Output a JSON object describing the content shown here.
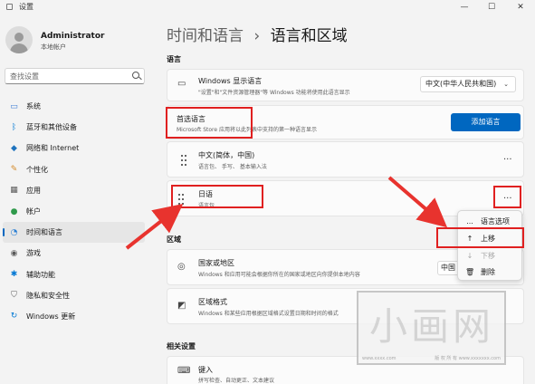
{
  "window": {
    "title": "设置",
    "controls": [
      "—",
      "☐",
      "✕"
    ]
  },
  "user": {
    "name": "Administrator",
    "account": "本地帐户"
  },
  "search": {
    "placeholder": "查找设置",
    "icon": "search-icon"
  },
  "sidebar": {
    "items": [
      {
        "label": "系统",
        "icon": "monitor-icon"
      },
      {
        "label": "蓝牙和其他设备",
        "icon": "bluetooth-icon"
      },
      {
        "label": "网络和 Internet",
        "icon": "wifi-icon"
      },
      {
        "label": "个性化",
        "icon": "brush-icon"
      },
      {
        "label": "应用",
        "icon": "apps-icon"
      },
      {
        "label": "帐户",
        "icon": "person-icon"
      },
      {
        "label": "时间和语言",
        "icon": "globe-clock-icon",
        "active": true
      },
      {
        "label": "游戏",
        "icon": "gamepad-icon"
      },
      {
        "label": "辅助功能",
        "icon": "accessibility-icon"
      },
      {
        "label": "隐私和安全性",
        "icon": "shield-icon"
      },
      {
        "label": "Windows 更新",
        "icon": "update-icon"
      }
    ]
  },
  "breadcrumb": {
    "parent": "时间和语言",
    "separator": "›",
    "current": "语言和区域"
  },
  "language_section": {
    "label": "语言",
    "display_language": {
      "title": "Windows 显示语言",
      "subtitle": "\"设置\"和\"文件资源管理器\"等 Windows 功能将使用此语言显示",
      "selected": "中文(中华人民共和国)"
    },
    "preferred": {
      "title": "首选语言",
      "subtitle": "Microsoft Store 应用将以此列表中支持的第一种语言显示",
      "button": "添加语言"
    },
    "languages": [
      {
        "name": "中文(简体，中国)",
        "features": "语言包、 手写、 基本输入法"
      },
      {
        "name": "日语",
        "features": "语言包"
      }
    ],
    "more_label": "..."
  },
  "context_menu": {
    "items": [
      {
        "label": "语言选项",
        "icon": "..."
      },
      {
        "label": "上移",
        "icon": "↑"
      },
      {
        "label": "下移",
        "icon": "↓",
        "disabled": true
      },
      {
        "label": "删除",
        "icon": "trash-icon"
      }
    ]
  },
  "region_section": {
    "label": "区域",
    "country": {
      "title": "国家或地区",
      "subtitle": "Windows 和应用可能会根据你所在的国家或地区向你提供本地内容",
      "selected": "中国"
    },
    "format": {
      "title": "区域格式",
      "subtitle": "Windows 和某些应用根据区域格式设置日期和时间的格式"
    }
  },
  "related_section": {
    "label": "相关设置",
    "typing": {
      "title": "键入",
      "subtitle": "拼写检查、自动更正、文本建议"
    }
  },
  "watermark": {
    "text": "小画网",
    "url_left": "www.xxxx.com",
    "url_right": "版 权 所 有  www.xxxxxxx.com"
  },
  "colors": {
    "accent": "#0067c0",
    "highlight": "#e02020",
    "background": "#f3f3f3"
  }
}
